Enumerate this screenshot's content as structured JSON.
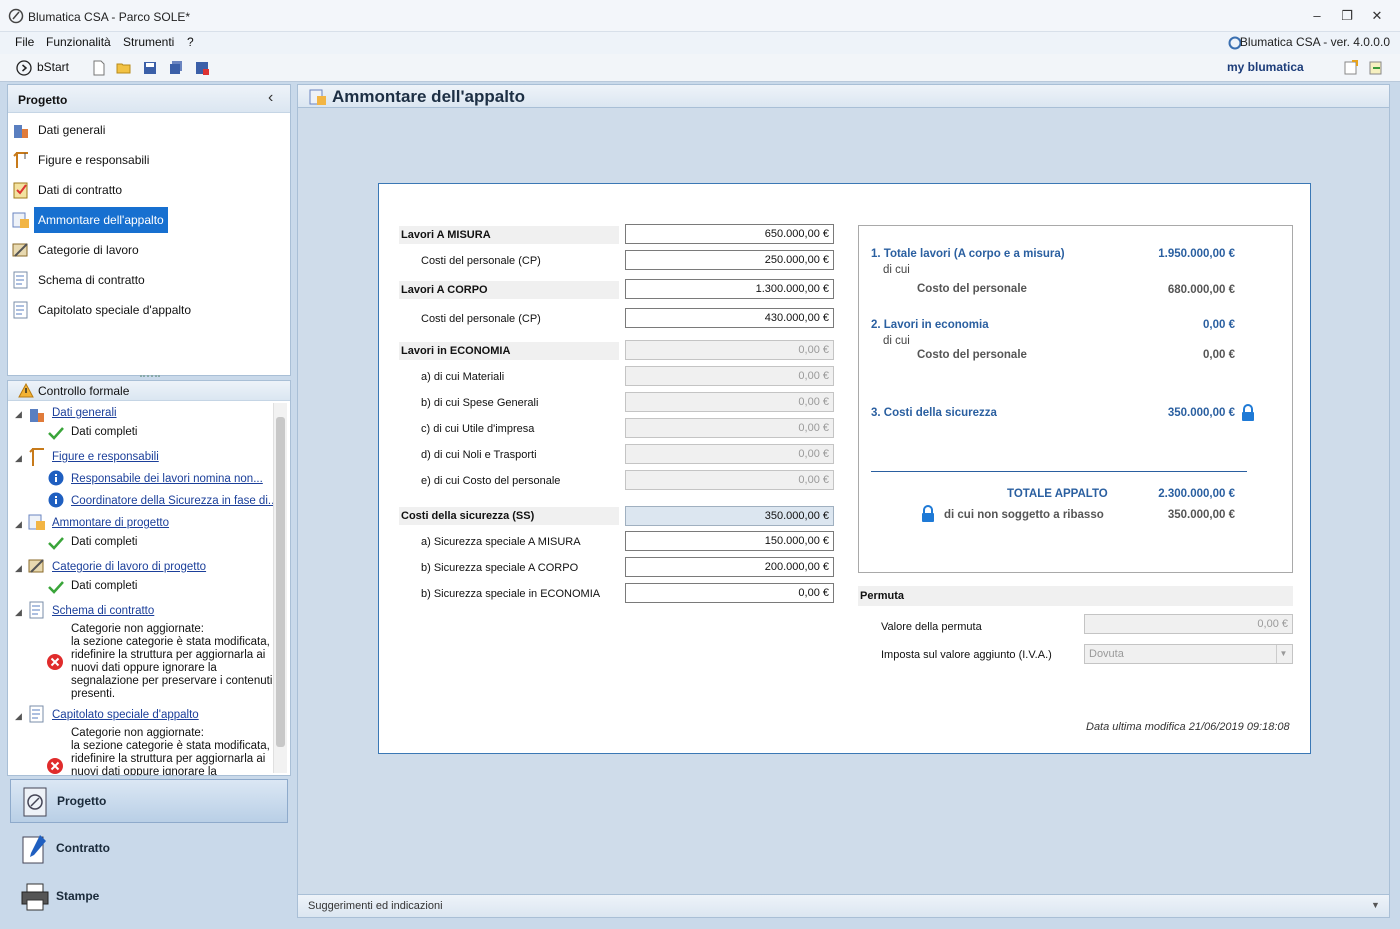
{
  "window": {
    "title": "Blumatica CSA - Parco SOLE*",
    "version": "Blumatica CSA - ver. 4.0.0.0"
  },
  "menu": [
    "File",
    "Funzionalità",
    "Strumenti",
    "?"
  ],
  "toolbar": {
    "bstart": "bStart",
    "brand": "my blumatica"
  },
  "nav": {
    "header": "Progetto",
    "collapse": "‹",
    "items": [
      {
        "label": "Dati generali",
        "icon": "building-icon"
      },
      {
        "label": "Figure e responsabili",
        "icon": "crane-icon"
      },
      {
        "label": "Dati di contratto",
        "icon": "contract-icon"
      },
      {
        "label": "Ammontare dell'appalto",
        "icon": "calculator-icon"
      },
      {
        "label": "Categorie di lavoro",
        "icon": "tools-icon"
      },
      {
        "label": "Schema di contratto",
        "icon": "schema-icon"
      },
      {
        "label": "Capitolato speciale d'appalto",
        "icon": "document-icon"
      }
    ]
  },
  "controllo": {
    "header": "Controllo formale",
    "groups": [
      {
        "label": "Dati generali",
        "children": [
          {
            "type": "ok",
            "text": "Dati completi"
          }
        ]
      },
      {
        "label": "Figure e responsabili",
        "children": [
          {
            "type": "info",
            "text": "Responsabile dei lavori nomina non..."
          },
          {
            "type": "info",
            "text": "Coordinatore della Sicurezza in fase di..."
          }
        ]
      },
      {
        "label": "Ammontare di progetto",
        "children": [
          {
            "type": "ok",
            "text": "Dati completi"
          }
        ]
      },
      {
        "label": "Categorie di lavoro di progetto",
        "children": [
          {
            "type": "ok",
            "text": "Dati completi"
          }
        ]
      },
      {
        "label": "Schema di contratto",
        "children": [
          {
            "type": "err",
            "lines": [
              "Categorie non aggiornate:",
              "la sezione categorie è stata modificata,",
              "ridefinire la struttura per aggiornarla ai",
              "nuovi dati oppure ignorare la",
              "segnalazione per preservare i contenuti",
              "presenti."
            ]
          }
        ]
      },
      {
        "label": "Capitolato speciale d'appalto",
        "children": [
          {
            "type": "err",
            "lines": [
              "Categorie non aggiornate:",
              "la sezione categorie è stata modificata,",
              "ridefinire la struttura per aggiornarla ai",
              "nuovi dati oppure ignorare la"
            ]
          }
        ]
      }
    ]
  },
  "bottom_nav": [
    "Progetto",
    "Contratto",
    "Stampe"
  ],
  "main": {
    "title": "Ammontare dell'appalto",
    "left": {
      "lavori_misura": {
        "label": "Lavori A MISURA",
        "value": "650.000,00 €"
      },
      "costi_pers_misura": {
        "label": "Costi del personale (CP)",
        "value": "250.000,00 €"
      },
      "lavori_corpo": {
        "label": "Lavori A CORPO",
        "value": "1.300.000,00 €"
      },
      "costi_pers_corpo": {
        "label": "Costi del personale (CP)",
        "value": "430.000,00 €"
      },
      "lavori_economia": {
        "label": "Lavori in ECONOMIA",
        "value": "0,00 €"
      },
      "eco_rows": [
        {
          "label": "a) di cui Materiali",
          "value": "0,00 €"
        },
        {
          "label": "b) di cui Spese Generali",
          "value": "0,00 €"
        },
        {
          "label": "c) di cui Utile d'impresa",
          "value": "0,00 €"
        },
        {
          "label": "d) di cui Noli e Trasporti",
          "value": "0,00 €"
        },
        {
          "label": "e) di cui Costo del personale",
          "value": "0,00 €"
        }
      ],
      "sicurezza": {
        "label": "Costi della sicurezza (SS)",
        "value": "350.000,00 €"
      },
      "sic_rows": [
        {
          "label": "a) Sicurezza speciale A MISURA",
          "value": "150.000,00 €"
        },
        {
          "label": "b) Sicurezza speciale A CORPO",
          "value": "200.000,00 €"
        },
        {
          "label": "b) Sicurezza speciale in ECONOMIA",
          "value": "0,00 €"
        }
      ]
    },
    "summary": {
      "totale_lavori": {
        "label": "1. Totale lavori (A corpo e a misura)",
        "value": "1.950.000,00 €"
      },
      "di_cui_1": "di cui",
      "costo_pers_1": {
        "label": "Costo del personale",
        "value": "680.000,00 €"
      },
      "lavori_economia": {
        "label": "2. Lavori in economia",
        "value": "0,00 €"
      },
      "di_cui_2": "di cui",
      "costo_pers_2": {
        "label": "Costo del personale",
        "value": "0,00 €"
      },
      "costi_sicurezza": {
        "label": "3. Costi della sicurezza",
        "value": "350.000,00 €"
      },
      "totale_appalto": {
        "label": "TOTALE APPALTO",
        "value": "2.300.000,00 €"
      },
      "non_ribasso": {
        "label": "di cui non soggetto a ribasso",
        "value": "350.000,00 €"
      }
    },
    "permuta": {
      "header": "Permuta",
      "valore_label": "Valore della permuta",
      "valore": "0,00 €",
      "iva_label": "Imposta sul valore aggiunto (I.V.A.)",
      "iva": "Dovuta"
    },
    "last_modified": "Data ultima modifica 21/06/2019 09:18:08"
  },
  "statusbar": "Suggerimenti ed indicazioni",
  "colors": {
    "accent": "#1770d0",
    "summary_blue": "#2a5fa0",
    "border_blue": "#3b78b5"
  }
}
